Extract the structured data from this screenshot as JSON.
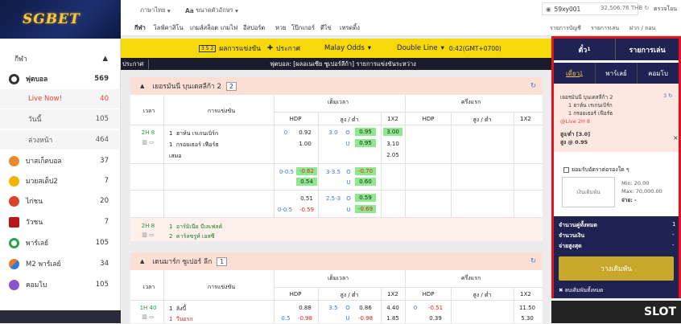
{
  "logo": "SGBET",
  "sidebar": {
    "header": "กีฬา",
    "sports": [
      {
        "label": "ฟุตบอล",
        "count": "569",
        "color": "#333"
      },
      {
        "label": "บาสเก็ตบอล",
        "count": "37",
        "color": "#e98b2c"
      },
      {
        "label": "มวยสเต็ป2",
        "count": "7",
        "color": "#f3b300"
      },
      {
        "label": "ไก่ชน",
        "count": "20",
        "color": "#d8432a"
      },
      {
        "label": "วัวชน",
        "count": "7",
        "color": "#b81717"
      },
      {
        "label": "พาร์เลย์",
        "count": "105",
        "color": "#2ca24a"
      },
      {
        "label": "M2 พาร์เลย์",
        "count": "34",
        "color": "#e8762c"
      },
      {
        "label": "คอมโบ",
        "count": "105",
        "color": "#8a55c8"
      }
    ],
    "football_sub": [
      {
        "label": "Live Now!",
        "count": "40"
      },
      {
        "label": "วันนี้",
        "count": "105"
      },
      {
        "label": "ล่วงหน้า",
        "count": "464"
      }
    ]
  },
  "topbar": {
    "lang": "ภาษาไทย",
    "font_size": "ขนาดตัวอักษร",
    "nav": [
      "กีฬา",
      "ไลฟ์คาสิโน",
      "เกมส์สล็อต",
      "เกมไฟ",
      "อีสปอร์ต",
      "หวย",
      "โป๊กเกอร์",
      "ตีไข่",
      "เทรดดิ้ง"
    ],
    "user": "59xy001",
    "balance": "32,506.76 THB",
    "right_link": "ตรวจโอน",
    "account_links": [
      "รายการบัญชี",
      "รายการเล่น",
      "ฝาก / ถอน"
    ]
  },
  "ybar": {
    "badge": "3 5 2",
    "results": "ผลการแข่งขัน",
    "announce": "ประกาศ",
    "odds_type": "Malay Odds",
    "line": "Double Line",
    "time": "0:42(GMT+0700)"
  },
  "marquee": {
    "label": "ประกาศ",
    "text": "ฟุตบอล: [ผลอเนเซีย ซูเปอร์ลีก้า] รายการแข่งขันระหว่าง"
  },
  "group1": {
    "title": "เยอรมันนี บุนเดสลีก้า 2",
    "count": "2",
    "headers": {
      "time": "เวลา",
      "match": "การแข่งขัน",
      "full": "เต็มเวลา",
      "half": "ครึ่งแรก",
      "hdp": "HDP",
      "ou": "สูง / ต่ำ",
      "x12": "1X2",
      "o": "O",
      "u": "U"
    },
    "m1": {
      "time": "2H 8",
      "home": "ฮาห์น เรเกนเบิร์ก",
      "away": "กรอยเธอร์ เฟือร์ธ",
      "draw": "เสมอ",
      "hdp_line": "0",
      "hdp_h": "0.92",
      "hdp_a": "1.00",
      "ou_line": "3.0",
      "ou_o": "0.95",
      "ou_u": "0.95",
      "x1": "3.00",
      "x2": "3.10",
      "xd": "2.05",
      "r2_line": "0-0.5",
      "r2_h": "-0.62",
      "r2_a": "0.54",
      "r2_ou": "3-3.5",
      "r2_o": "-0.70",
      "r2_u": "0.60",
      "r3_h": "0.51",
      "r3_line": "0-0.5",
      "r3_a": "-0.59",
      "r3_ou": "2.5-3",
      "r3_o": "0.59",
      "r3_u": "-0.69"
    },
    "m2": {
      "time": "2H 8",
      "h_num": "1",
      "a_num": "2",
      "home": "อาร์มิเนีย บีเลเฟลด์",
      "away": "คาร์ลซรูห์ เอสซี"
    }
  },
  "group2": {
    "title": "เดนมาร์ก ซูเปอร์ ลีก",
    "count": "1",
    "m1": {
      "time": "1H 40",
      "home": "ลิงบี้",
      "away": "วีบอรก",
      "hdp_h": "0.88",
      "hdp_line": "0.5",
      "hdp_a": "-0.98",
      "ou_line": "3.5",
      "ou_o": "0.86",
      "ou_u": "-0.98",
      "x1": "4.40",
      "x2": "1.85",
      "h_hdp_line": "0",
      "h_hdp_h": "-0.51",
      "h_hdp_a": "0.39",
      "h_x1": "11.50",
      "h_x2": "5.30"
    }
  },
  "slip": {
    "tab1": "ตั๋ว",
    "tab1_badge": "1",
    "tab2": "รายการเล่น",
    "sub_tabs": [
      "เดี่ยว",
      "พาร์เลย์",
      "คอมโบ"
    ],
    "sub_badge": "1",
    "league": "เยอรมันนี บุนเดสลีก้า 2",
    "home_line": "1  ฮาห์น เรเกนเบิร์ก",
    "away_line": "1  กรอยเธอร์ เฟือร์ธ",
    "live": "@Live 2H 8",
    "market": "สูง/ต่ำ [3.0]",
    "pick": "สูง @ 0.95",
    "counter": "3",
    "accept": "ยอมรับอัตราต่อรองใด ๆ",
    "stake_label": "เงินเดิมพัน",
    "min": "Min: 20.00",
    "max": "Max: 70,000.00",
    "pay": "จ่าย: -",
    "rows": [
      {
        "label": "จำนวนคู่ทั้งหมด",
        "value": "1"
      },
      {
        "label": "จำนวนเงิน",
        "value": "-"
      },
      {
        "label": "จ่ายสูงสุด",
        "value": "-"
      }
    ],
    "place": "วางเดิมพัน",
    "clear": "ลบเดิมพันทั้งหมด"
  },
  "slot_label": "SLOT"
}
